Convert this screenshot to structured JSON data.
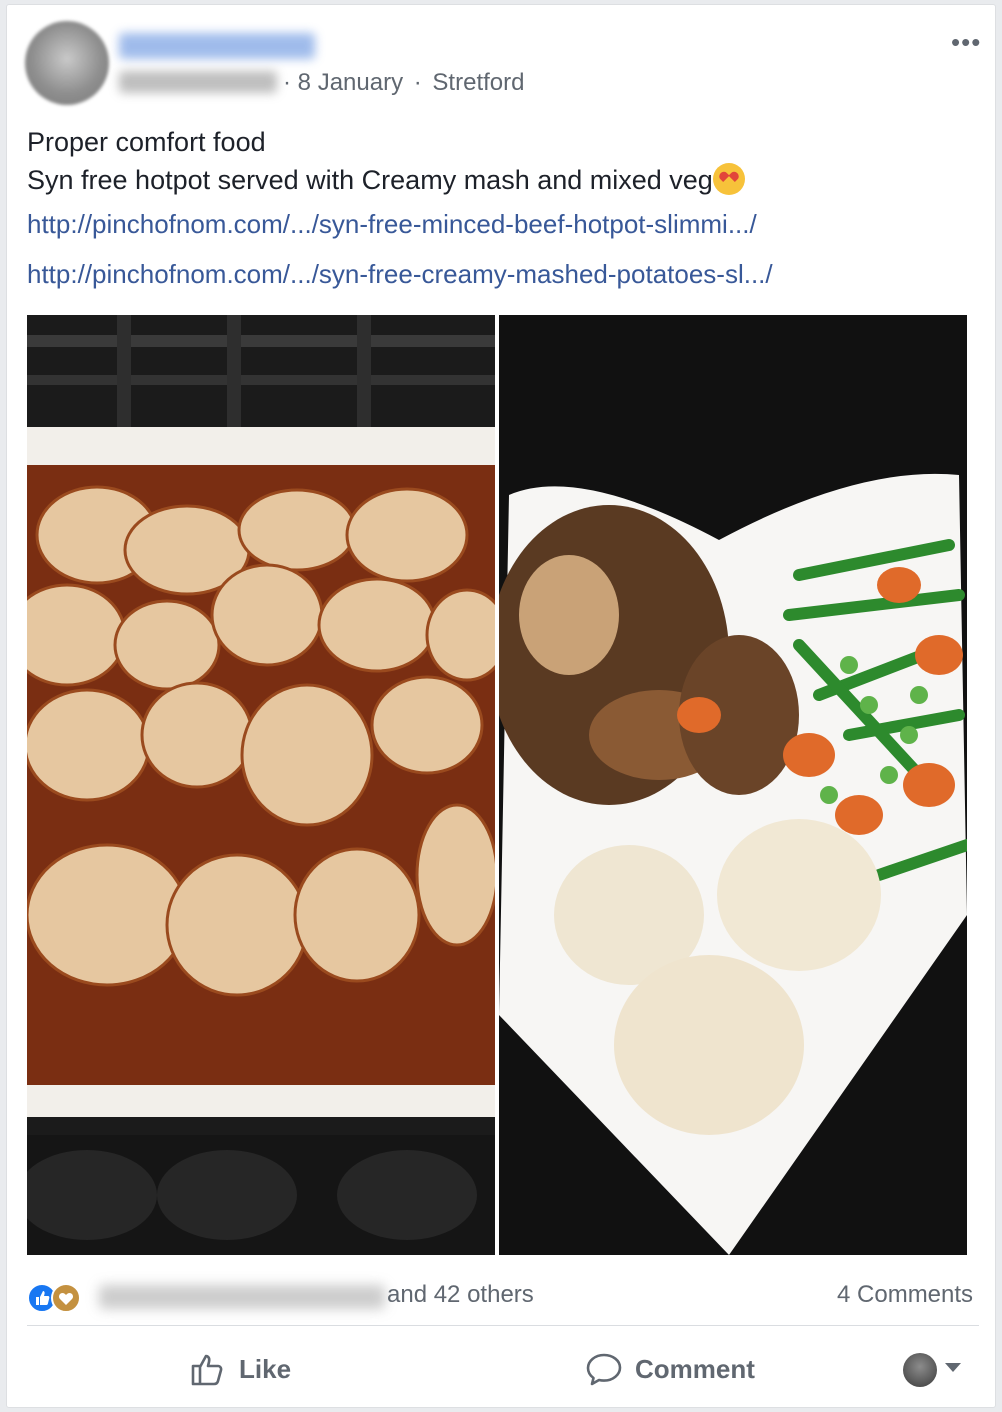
{
  "post": {
    "date": "8 January",
    "separator": "·",
    "location": "Stretford",
    "more_label": "•••",
    "text_line1": "Proper comfort food",
    "text_line2": "Syn free hotpot served with Creamy mash and mixed veg",
    "emoji_icon": "heart-eyes-emoji-icon",
    "link1": "http://pinchofnom.com/.../syn-free-minced-beef-hotpot-slimmi.../",
    "link2": "http://pinchofnom.com/.../syn-free-creamy-mashed-potatoes-sl.../"
  },
  "reactions": {
    "icons": [
      "like-reaction-icon",
      "love-reaction-icon"
    ],
    "others_text": "and 42 others",
    "comments_text": "4 Comments"
  },
  "actions": {
    "like_label": "Like",
    "comment_label": "Comment"
  },
  "colors": {
    "link": "#385898",
    "meta": "#606770",
    "like_blue": "#1877f2"
  }
}
